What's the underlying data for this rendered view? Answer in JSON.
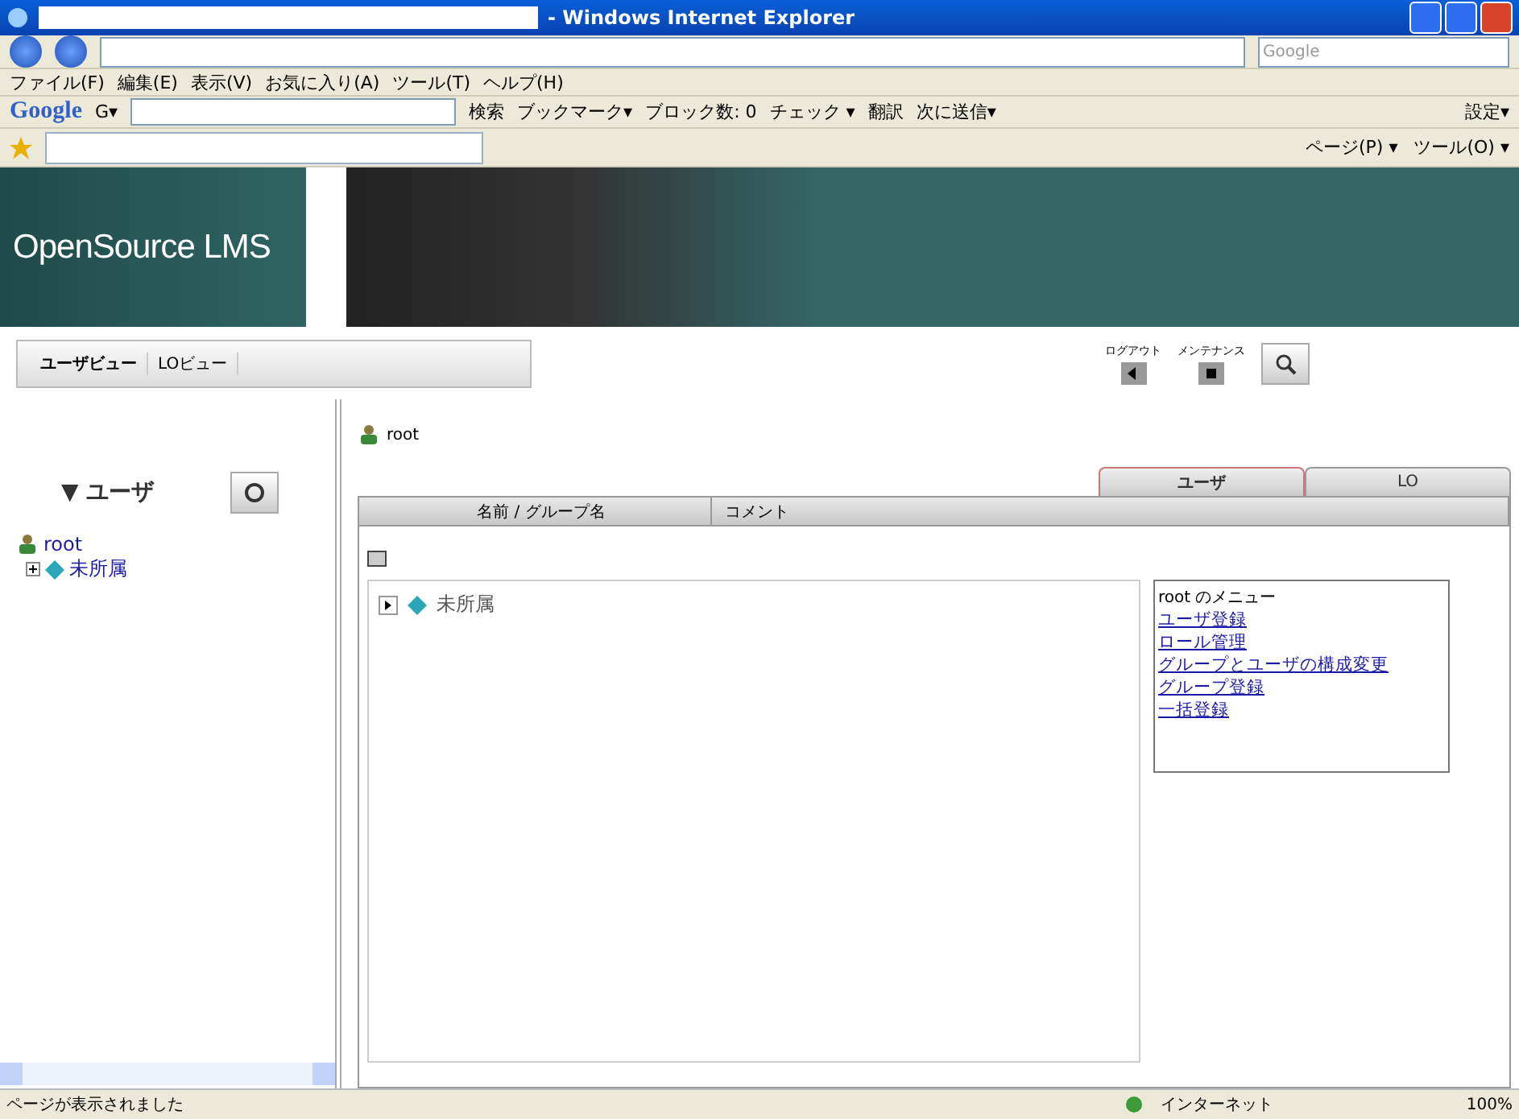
{
  "window": {
    "title": "- Windows Internet Explorer"
  },
  "address_bar": {
    "search_placeholder": "Google"
  },
  "menu_bar": [
    "ファイル(F)",
    "編集(E)",
    "表示(V)",
    "お気に入り(A)",
    "ツール(T)",
    "ヘルプ(H)"
  ],
  "google_toolbar": {
    "logo": "Google",
    "g_button": "G▾",
    "search": "検索",
    "items": [
      "ブックマーク▾",
      "ブロック数: 0",
      "チェック ▾",
      "翻訳",
      "次に送信▾"
    ],
    "settings": "設定▾"
  },
  "command_bar": [
    "ページ(P) ▾",
    "ツール(O) ▾"
  ],
  "site": {
    "logo": "OpenSource LMS",
    "view_tabs": [
      {
        "label": "ユーザビュー",
        "selected": true
      },
      {
        "label": "LOビュー",
        "selected": false
      }
    ],
    "header_buttons": [
      {
        "label": "ログアウト",
        "kind": "logout"
      },
      {
        "label": "メンテナンス",
        "kind": "maintenance"
      }
    ],
    "sidebar": {
      "title": "▼ ユーザ",
      "tree": [
        {
          "label": "root",
          "kind": "root",
          "children": [
            {
              "label": "未所属",
              "kind": "group",
              "expanded": false
            }
          ]
        }
      ]
    },
    "breadcrumb": "root",
    "panel_tabs": [
      {
        "label": "ユーザ",
        "selected": true
      },
      {
        "label": "LO",
        "selected": false
      }
    ],
    "table": {
      "columns": [
        "名前 / グループ名",
        "コメント"
      ]
    },
    "list": [
      {
        "label": "未所属",
        "expanded": false
      }
    ],
    "menu": {
      "title": "root のメニュー",
      "links": [
        "ユーザ登録",
        "ロール管理",
        "グループとユーザの構成変更",
        "グループ登録",
        "一括登録"
      ]
    }
  },
  "status_bar": {
    "message": "ページが表示されました",
    "zone": "インターネット",
    "zoom": "100%"
  }
}
